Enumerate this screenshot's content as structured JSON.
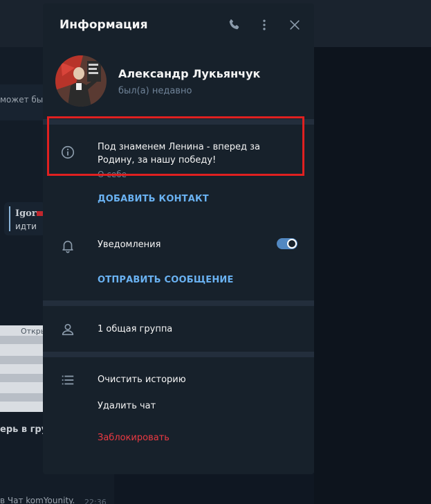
{
  "background": {
    "partial_message": "может быт",
    "quote_name": "Igor",
    "quote_text": "идти",
    "table_header": "Откры",
    "bold_snippet": "ерь в груп",
    "bottom_snippet": "в Чат komYounity.",
    "bottom_time": "22:36"
  },
  "modal": {
    "title": "Информация",
    "header_icons": [
      "phone-icon",
      "more-vertical-icon",
      "close-icon"
    ],
    "profile": {
      "name": "Александр Лукьянчук",
      "status": "был(а) недавно"
    },
    "bio": {
      "text": "Под знаменем Ленина - вперед за Родину, за нашу победу!",
      "label": "О себе"
    },
    "add_contact_label": "ДОБАВИТЬ КОНТАКТ",
    "notifications": {
      "label": "Уведомления",
      "enabled": true
    },
    "send_message_label": "ОТПРАВИТЬ СООБЩЕНИЕ",
    "groups_label": "1 общая группа",
    "clear_history_label": "Очистить историю",
    "delete_chat_label": "Удалить чат",
    "block_label": "Заблокировать"
  },
  "colors": {
    "modal_bg": "#17212b",
    "accent": "#6ab2f2",
    "toggle": "#5288c1",
    "danger": "#ec3942",
    "muted": "#708499",
    "highlight": "#e02020"
  }
}
